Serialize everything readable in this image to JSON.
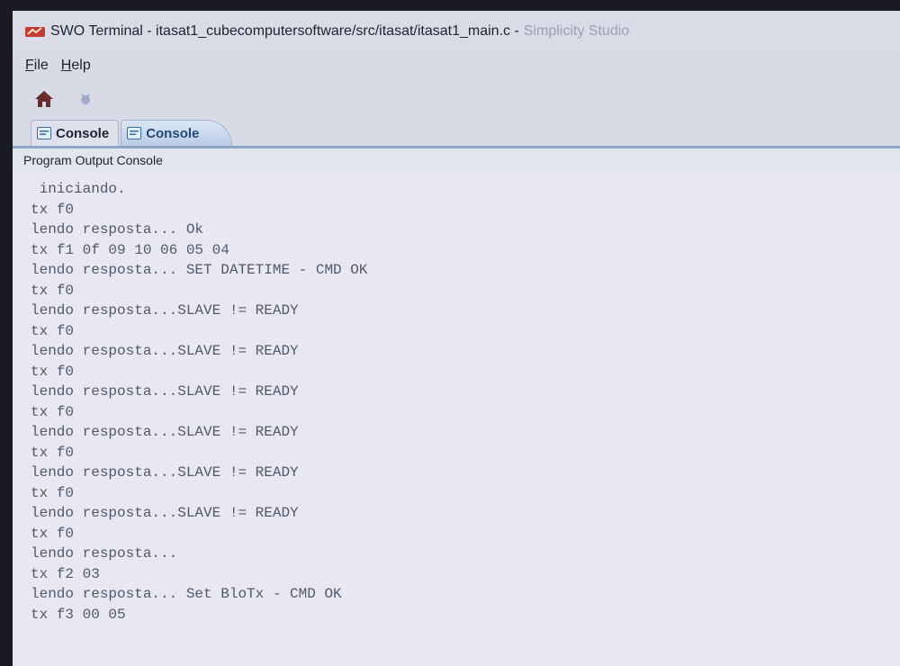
{
  "window": {
    "title": "SWO Terminal - itasat1_cubecomputersoftware/src/itasat/itasat1_main.c -",
    "app_name": "Simplicity Studio"
  },
  "menu": {
    "items": [
      {
        "label": "File",
        "accel": "F",
        "rest": "ile"
      },
      {
        "label": "Help",
        "accel": "H",
        "rest": "elp"
      }
    ]
  },
  "toolbar": {
    "buttons": [
      {
        "icon": "home-icon"
      },
      {
        "icon": "debug-icon"
      }
    ]
  },
  "tabs": [
    {
      "label": "Console",
      "active": false
    },
    {
      "label": "Console",
      "active": true
    }
  ],
  "console": {
    "header": "Program Output Console",
    "lines": [
      " iniciando.",
      "tx f0",
      "lendo resposta... Ok",
      "tx f1 0f 09 10 06 05 04",
      "lendo resposta... SET DATETIME - CMD OK",
      "tx f0",
      "lendo resposta...SLAVE != READY",
      "tx f0",
      "lendo resposta...SLAVE != READY",
      "tx f0",
      "lendo resposta...SLAVE != READY",
      "tx f0",
      "lendo resposta...SLAVE != READY",
      "tx f0",
      "lendo resposta...SLAVE != READY",
      "tx f0",
      "lendo resposta...SLAVE != READY",
      "tx f0",
      "lendo resposta...",
      "tx f2 03",
      "lendo resposta... Set BloTx - CMD OK",
      "tx f3 00 05"
    ]
  },
  "colors": {
    "accent_tab": "#b9cbe6",
    "console_text": "#54576a",
    "console_bg": "#e7e8f2"
  }
}
